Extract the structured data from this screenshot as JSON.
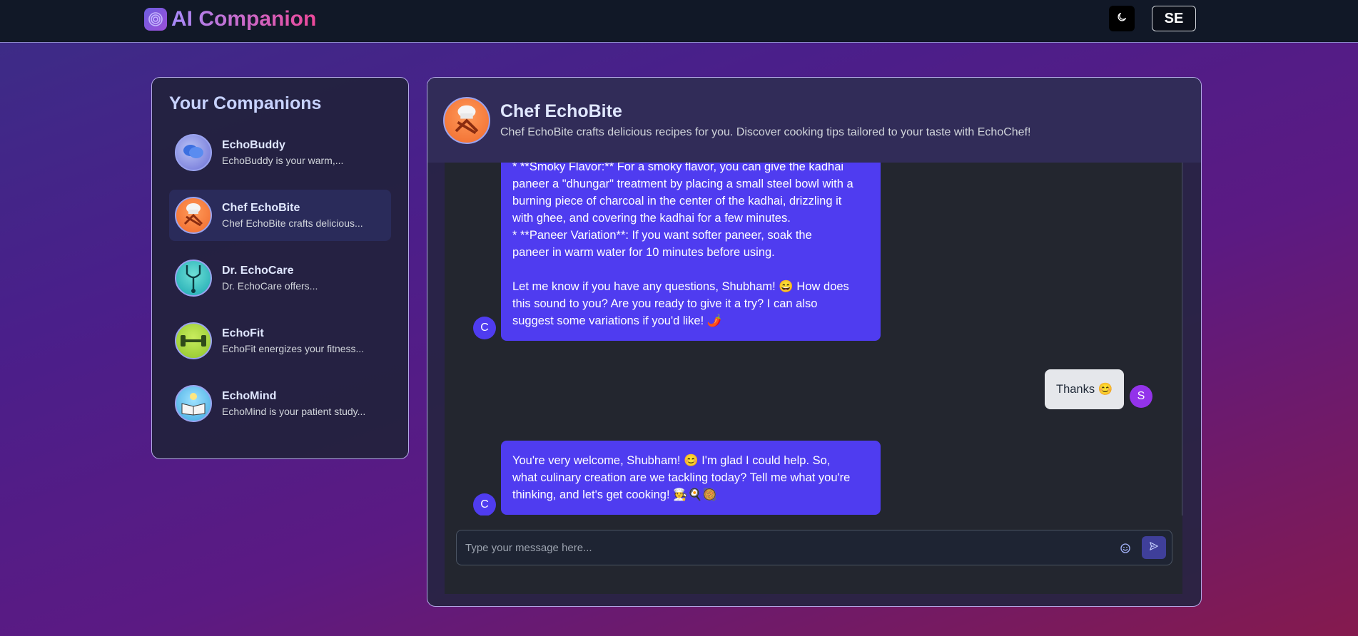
{
  "app": {
    "title": "AI Companion",
    "user_initials": "SE"
  },
  "sidebar": {
    "title": "Your Companions",
    "items": [
      {
        "name": "EchoBuddy",
        "desc": "EchoBuddy is your warm,..."
      },
      {
        "name": "Chef EchoBite",
        "desc": "Chef EchoBite crafts delicious..."
      },
      {
        "name": "Dr. EchoCare",
        "desc": "Dr. EchoCare offers..."
      },
      {
        "name": "EchoFit",
        "desc": "EchoFit energizes your fitness..."
      },
      {
        "name": "EchoMind",
        "desc": "EchoMind is your patient study..."
      }
    ]
  },
  "chat": {
    "title": "Chef EchoBite",
    "subtitle": "Chef EchoBite crafts delicious recipes for you. Discover cooking tips tailored to your taste with EchoChef!",
    "bot_initial": "C",
    "user_initial": "S",
    "messages": [
      {
        "role": "bot",
        "lines": [
          "*   **Smoky Flavor:** For a smoky flavor, you can give the kadhai",
          "paneer a \"dhungar\" treatment by placing a small steel bowl with a",
          "burning piece of charcoal in the center of the kadhai, drizzling it",
          "with ghee, and covering the kadhai for a few minutes.",
          "*   **Paneer Variation**: If you want softer paneer, soak the",
          "paneer in warm water for 10 minutes before using.",
          "",
          "Let me know if you have any questions, Shubham! 😄 How does",
          "this sound to you? Are you ready to give it a try? I can also",
          "suggest some variations if you'd like! 🌶️"
        ]
      },
      {
        "role": "user",
        "text": "Thanks 😊"
      },
      {
        "role": "bot",
        "lines": [
          "You're very welcome, Shubham! 😊 I'm glad I could help. So,",
          "what culinary creation are we tackling today? Tell me what you're",
          "thinking, and let's get cooking! 🧑‍🍳🍳🥘"
        ]
      }
    ],
    "input_placeholder": "Type your message here..."
  },
  "icons": {
    "logo": "spiral-logo-icon",
    "theme": "moon-icon",
    "emoji": "smiley-icon",
    "send": "send-arrow-icon"
  },
  "colors": {
    "accent": "#4f3cf0",
    "user_badge": "#9333ea",
    "topbar": "#111827"
  }
}
